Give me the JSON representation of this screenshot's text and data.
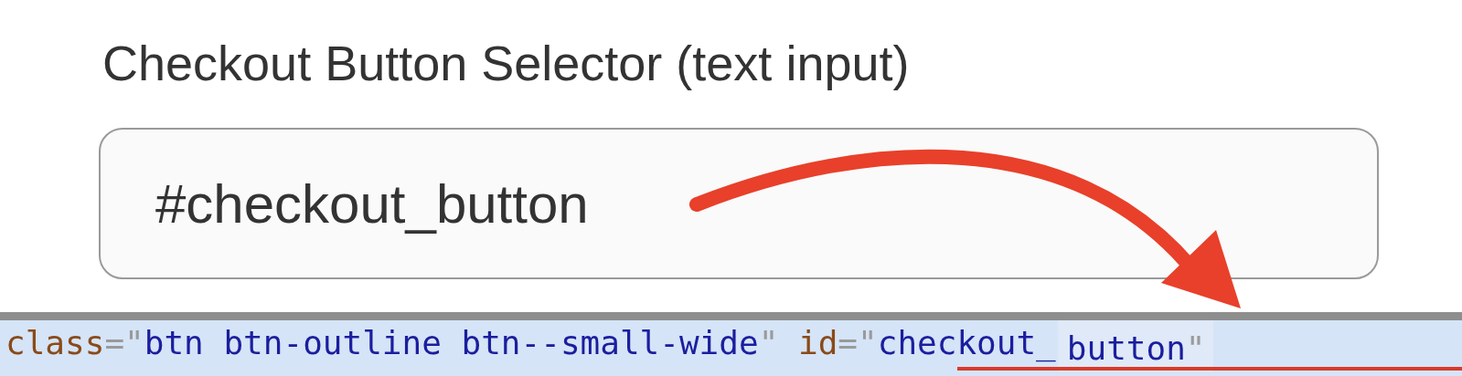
{
  "field": {
    "label": "Checkout Button Selector (text input)",
    "value": "#checkout_button"
  },
  "code_line": {
    "tokens": [
      {
        "kind": "attr",
        "text": "class"
      },
      {
        "kind": "punct",
        "text": "=\""
      },
      {
        "kind": "value",
        "text": "btn btn-outline btn--small-wide"
      },
      {
        "kind": "punct",
        "text": "\" "
      },
      {
        "kind": "attr",
        "text": "id"
      },
      {
        "kind": "punct",
        "text": "=\""
      },
      {
        "kind": "value",
        "text": "checkout_"
      }
    ],
    "fragment": [
      {
        "kind": "value",
        "text": "button"
      },
      {
        "kind": "punct",
        "text": "\""
      }
    ]
  }
}
